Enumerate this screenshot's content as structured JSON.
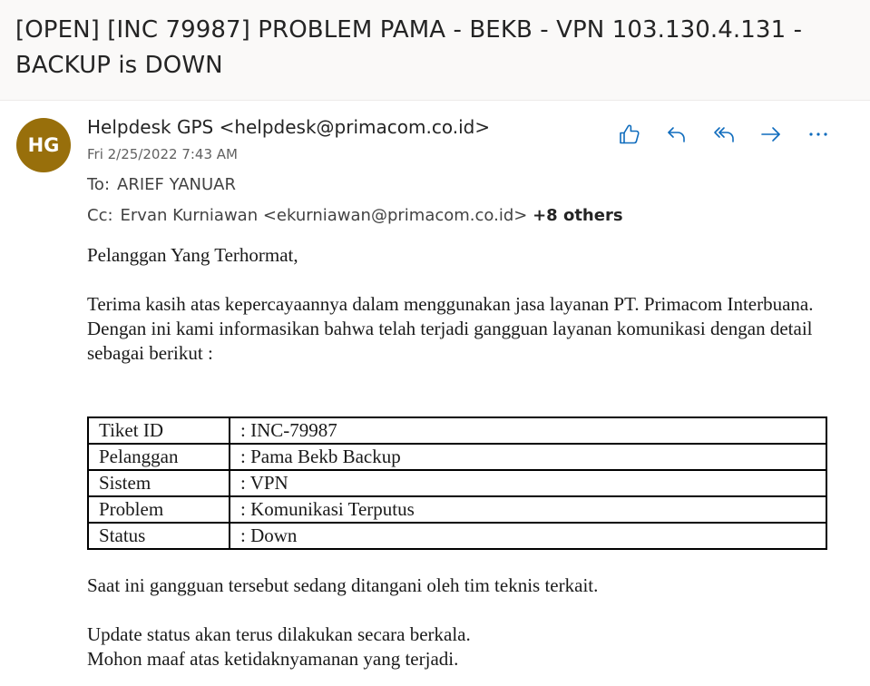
{
  "subject": "[OPEN] [INC 79987] PROBLEM PAMA - BEKB - VPN 103.130.4.131 - BACKUP is DOWN",
  "sender": {
    "initials": "HG",
    "avatar_color": "#986f0b",
    "display": "Helpdesk GPS <helpdesk@primacom.co.id>",
    "date": "Fri 2/25/2022 7:43 AM"
  },
  "recipients": {
    "to_label": "To:",
    "to": "ARIEF YANUAR",
    "cc_label": "Cc:",
    "cc": "Ervan Kurniawan <ekurniawan@primacom.co.id>",
    "cc_more": "+8 others"
  },
  "actions": [
    {
      "name": "like-icon"
    },
    {
      "name": "reply-icon"
    },
    {
      "name": "reply-all-icon"
    },
    {
      "name": "forward-icon"
    },
    {
      "name": "more-icon"
    }
  ],
  "accent_color": "#0f6cbd",
  "body": {
    "greeting": "Pelanggan Yang Terhormat,",
    "p1": "Terima kasih atas kepercayaannya dalam menggunakan jasa layanan PT. Primacom Interbuana.",
    "p2": "Dengan ini kami informasikan bahwa telah terjadi gangguan layanan komunikasi dengan detail sebagai berikut :",
    "ticket": [
      {
        "key": "Tiket ID",
        "value": ": INC-79987"
      },
      {
        "key": "Pelanggan",
        "value": ": Pama Bekb Backup"
      },
      {
        "key": "Sistem",
        "value": ": VPN"
      },
      {
        "key": "Problem",
        "value": ": Komunikasi Terputus"
      },
      {
        "key": "Status",
        "value": ": Down"
      }
    ],
    "p3": "Saat ini gangguan tersebut sedang ditangani oleh tim teknis terkait.",
    "p4": "Update status akan terus dilakukan secara berkala.",
    "p5": "Mohon maaf atas ketidaknyamanan yang terjadi."
  }
}
